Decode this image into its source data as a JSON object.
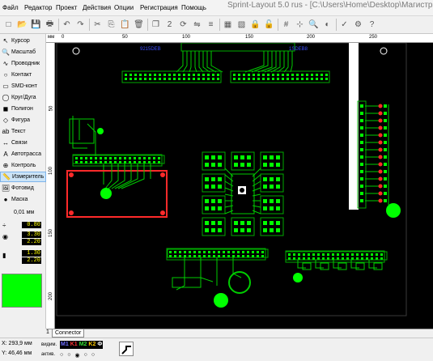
{
  "window": {
    "title": "Sprint-Layout 5.0 rus - [C:\\Users\\Home\\Desktop\\Магистратура"
  },
  "menu": [
    "Файл",
    "Редактор",
    "Проект",
    "Действия",
    "Опции",
    "Регистрация",
    "Помощь"
  ],
  "toolbar": {
    "icons": [
      "new-icon",
      "open-icon",
      "save-icon",
      "print-icon",
      "undo-icon",
      "redo-icon",
      "cut-icon",
      "copy-icon",
      "paste-icon",
      "delete-icon",
      "duplicate-icon",
      "x2-icon",
      "rotate-icon",
      "mirror-icon",
      "align-icon",
      "group-icon",
      "ungroup-icon",
      "lock-icon",
      "unlock-icon",
      "grid-icon",
      "snap-icon",
      "zoom-icon",
      "contrast-icon",
      "drc-icon",
      "settings-icon",
      "help-icon"
    ]
  },
  "tools": [
    {
      "label": "Курсор",
      "icon": "cursor-icon"
    },
    {
      "label": "Масштаб",
      "icon": "zoom-icon"
    },
    {
      "label": "Проводник",
      "icon": "track-icon"
    },
    {
      "label": "Контакт",
      "icon": "pad-icon"
    },
    {
      "label": "SMD-конт",
      "icon": "smd-pad-icon"
    },
    {
      "label": "Круг/Дуга",
      "icon": "circle-icon"
    },
    {
      "label": "Полигон",
      "icon": "polygon-icon"
    },
    {
      "label": "Фигура",
      "icon": "shape-icon"
    },
    {
      "label": "Текст",
      "icon": "text-icon"
    },
    {
      "label": "Связи",
      "icon": "connections-icon"
    },
    {
      "label": "Автотрасса",
      "icon": "autoroute-icon"
    },
    {
      "label": "Контроль",
      "icon": "test-icon"
    },
    {
      "label": "Измеритель",
      "icon": "measure-icon"
    },
    {
      "label": "Фотовид",
      "icon": "photoview-icon"
    },
    {
      "label": "Маска",
      "icon": "mask-icon"
    }
  ],
  "active_tool": "Измеритель",
  "grid": {
    "value": "0,01 мм"
  },
  "dimensions": [
    "0.80",
    "3.30",
    "2.20",
    "1.30",
    "2.20"
  ],
  "colors": {
    "active_layer": "#00ff00",
    "canvas": "#000000",
    "copper": "#00ff00",
    "copper_dark": "#009900",
    "pads": "#555555",
    "silkscreen": "#ff0000",
    "board_text": "#3b4bff"
  },
  "ruler": {
    "unit": "мм",
    "h_labels": [
      "0",
      "50",
      "100",
      "150",
      "200",
      "250"
    ],
    "v_labels": [
      "50",
      "100",
      "150",
      "200"
    ]
  },
  "board_labels": [
    "9215DEB",
    "1SDEB8"
  ],
  "tabs": [
    {
      "label": "Connector"
    }
  ],
  "tab_marker": "1",
  "status": {
    "x": "X:   293,9 мм",
    "y": "Y:   46,46 мм",
    "visible_label": "видим.",
    "active_label": "актив.",
    "layers": [
      {
        "name": "M1",
        "color": "#6e6eff"
      },
      {
        "name": "K1",
        "color": "#ff3333"
      },
      {
        "name": "M2",
        "color": "#33dd33"
      },
      {
        "name": "K2",
        "color": "#ffcc00"
      },
      {
        "name": "Ф",
        "color": "#ffffff"
      }
    ]
  }
}
